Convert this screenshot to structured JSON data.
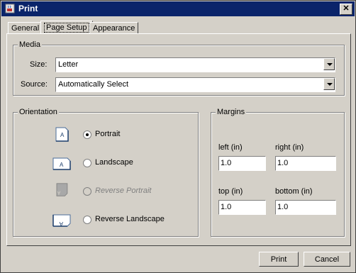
{
  "window": {
    "title": "Print",
    "close_glyph": "✕"
  },
  "tabs": [
    {
      "label": "General"
    },
    {
      "label": "Page Setup"
    },
    {
      "label": "Appearance"
    }
  ],
  "media": {
    "legend": "Media",
    "size_label": "Size:",
    "size_value": "Letter",
    "source_label": "Source:",
    "source_value": "Automatically Select"
  },
  "orientation": {
    "legend": "Orientation",
    "options": [
      {
        "label": "Portrait",
        "selected": true,
        "enabled": true
      },
      {
        "label": "Landscape",
        "selected": false,
        "enabled": true
      },
      {
        "label": "Reverse Portrait",
        "selected": false,
        "enabled": false
      },
      {
        "label": "Reverse Landscape",
        "selected": false,
        "enabled": true
      }
    ]
  },
  "margins": {
    "legend": "Margins",
    "left_label": "left (in)",
    "left_value": "1.0",
    "right_label": "right (in)",
    "right_value": "1.0",
    "top_label": "top (in)",
    "top_value": "1.0",
    "bottom_label": "bottom (in)",
    "bottom_value": "1.0"
  },
  "buttons": {
    "print": "Print",
    "cancel": "Cancel"
  },
  "colors": {
    "titlebar": "#0a246a",
    "face": "#d4d0c8"
  }
}
